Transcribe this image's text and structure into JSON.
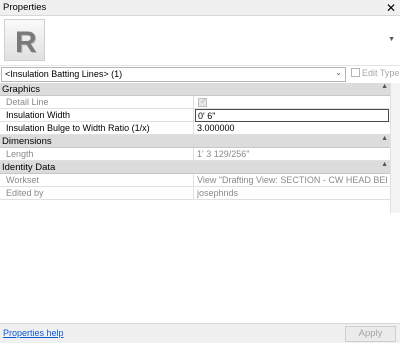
{
  "window": {
    "title": "Properties"
  },
  "type_selector": {
    "value": "<Insulation Batting Lines> (1)",
    "edit_type_label": "Edit Type"
  },
  "groups": [
    {
      "name": "Graphics",
      "params": [
        {
          "name": "Detail Line",
          "value": "",
          "checked": true,
          "read_only": true
        },
        {
          "name": "Insulation Width",
          "value": "0'  6\"",
          "read_only": false
        },
        {
          "name": "Insulation Bulge to Width Ratio (1/x)",
          "value": "3.000000",
          "read_only": false
        }
      ]
    },
    {
      "name": "Dimensions",
      "params": [
        {
          "name": "Length",
          "value": "1'  3 129/256\"",
          "read_only": true
        }
      ]
    },
    {
      "name": "Identity Data",
      "params": [
        {
          "name": "Workset",
          "value": "View \"Drafting View: SECTION - CW HEAD BELO...",
          "read_only": true
        },
        {
          "name": "Edited by",
          "value": "josephnds",
          "read_only": true
        }
      ]
    }
  ],
  "footer": {
    "help_link": "Properties help",
    "apply_label": "Apply"
  },
  "colors": {
    "accent_link": "#0b5bd3",
    "group_header": "#dcdcdc"
  }
}
